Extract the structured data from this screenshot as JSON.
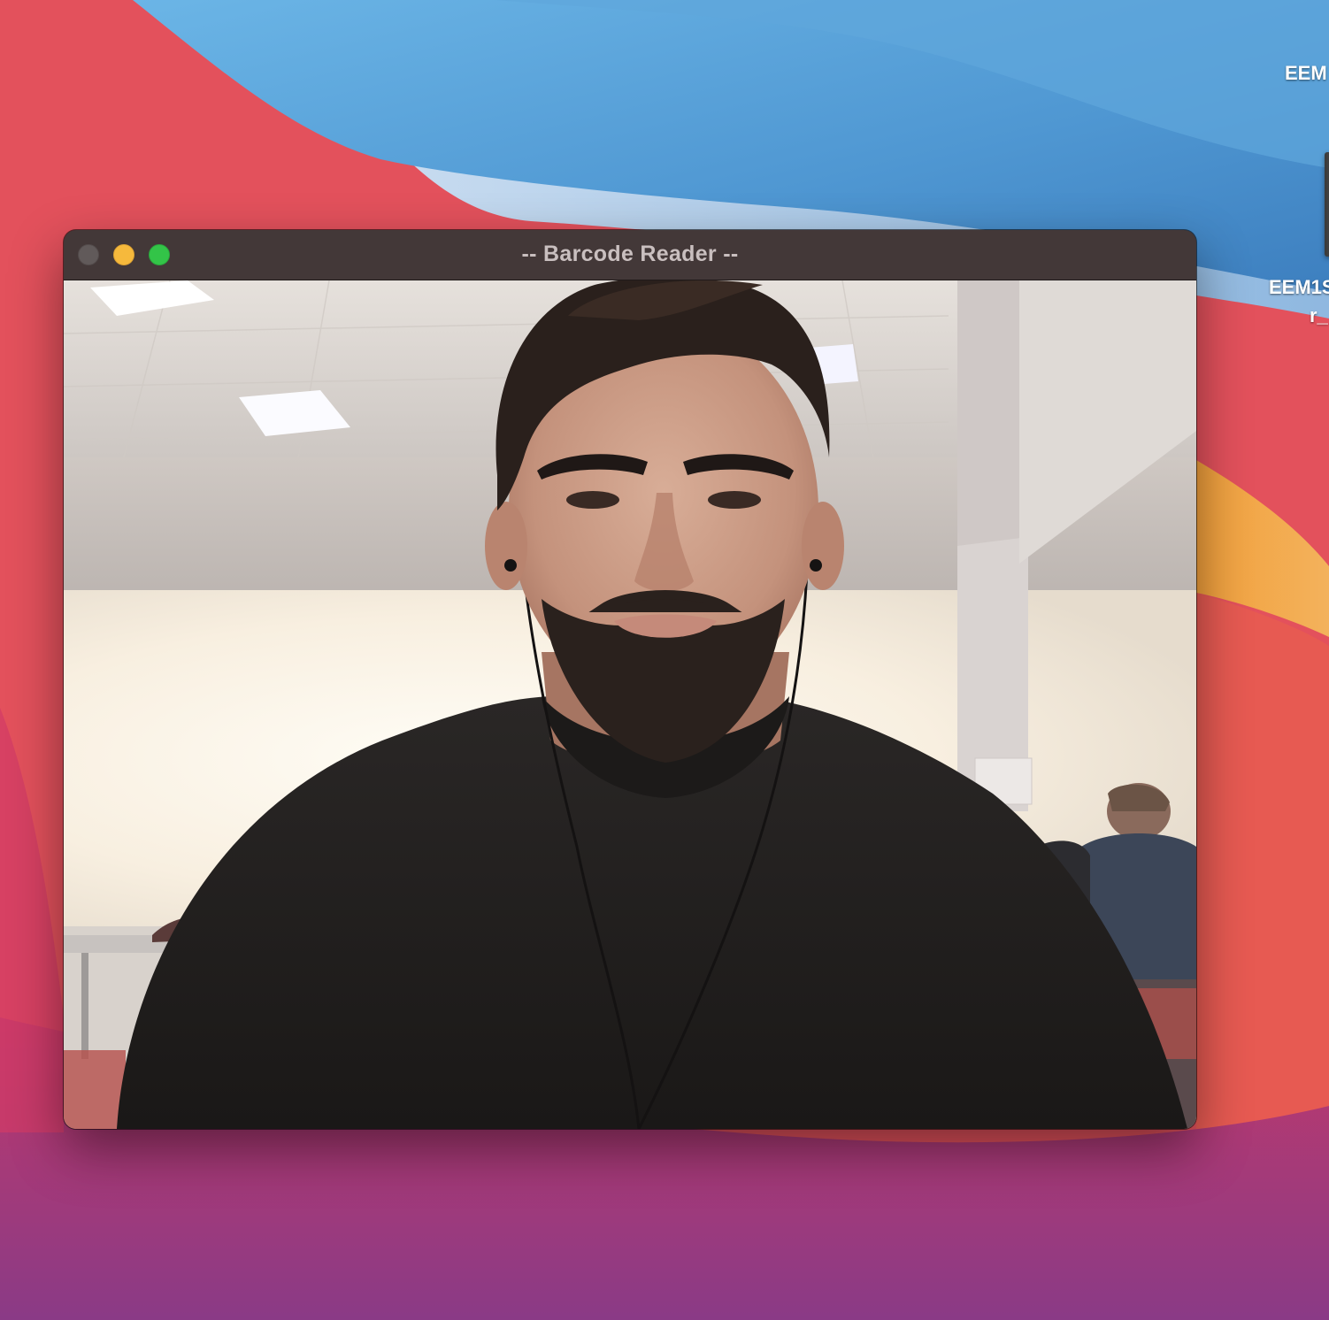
{
  "window": {
    "title": "-- Barcode Reader --",
    "controls": {
      "close": "close-button",
      "minimize": "minimize-button",
      "maximize": "maximize-button"
    }
  },
  "desktop": {
    "icons": [
      {
        "label": "EEM"
      },
      {
        "label_line1": "EEM1S",
        "label_line2": "r_"
      }
    ]
  },
  "feed": {
    "icon": "camera-preview"
  },
  "colors": {
    "titlebar": "#433838",
    "title_text": "#c9bfbf",
    "close": "#615a5a",
    "minimize": "#f6b93c",
    "maximize": "#33c448"
  }
}
